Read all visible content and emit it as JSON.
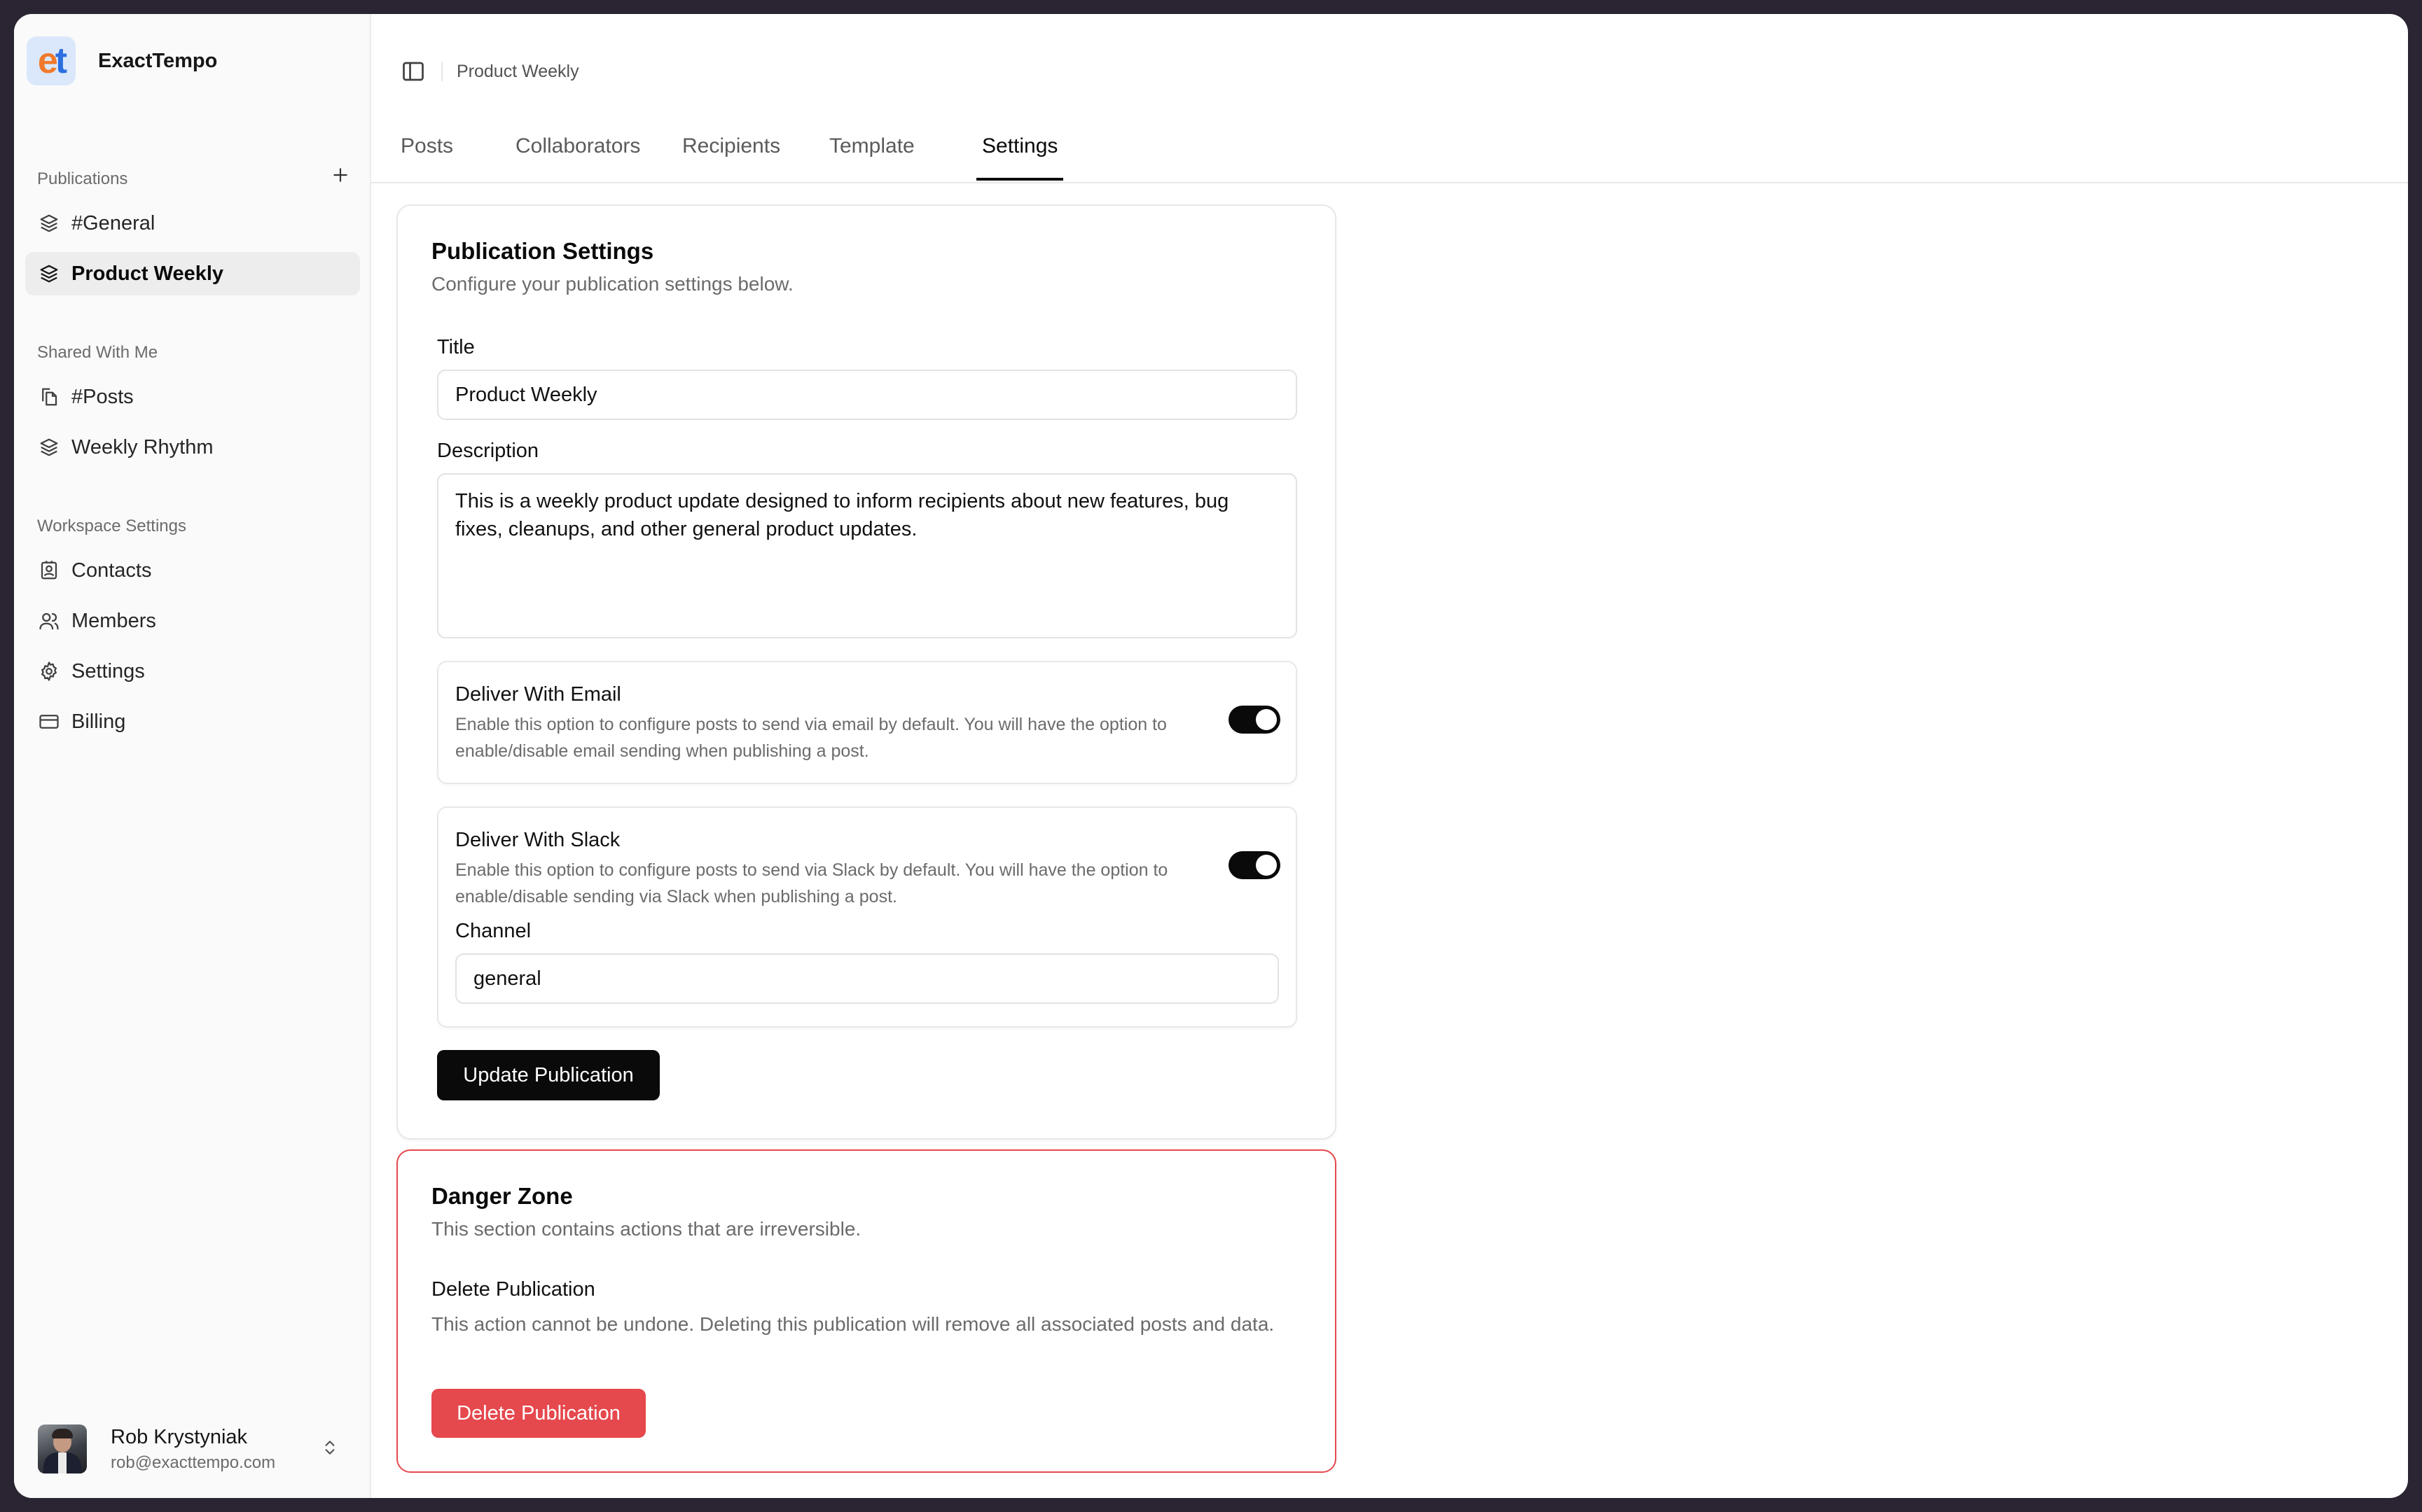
{
  "brand": {
    "logo_text_e": "e",
    "logo_text_t": "t",
    "name": "ExactTempo"
  },
  "sidebar": {
    "publications_label": "Publications",
    "publications": [
      {
        "label": "#General",
        "icon": "layers-icon"
      },
      {
        "label": "Product Weekly",
        "icon": "layers-icon",
        "active": true
      }
    ],
    "shared_label": "Shared With Me",
    "shared": [
      {
        "label": "#Posts",
        "icon": "files-icon"
      },
      {
        "label": "Weekly Rhythm",
        "icon": "layers-icon"
      }
    ],
    "workspace_label": "Workspace Settings",
    "workspace": [
      {
        "label": "Contacts",
        "icon": "contact-icon"
      },
      {
        "label": "Members",
        "icon": "users-icon"
      },
      {
        "label": "Settings",
        "icon": "gear-icon"
      },
      {
        "label": "Billing",
        "icon": "credit-card-icon"
      }
    ],
    "user": {
      "name": "Rob Krystyniak",
      "email": "rob@exacttempo.com"
    }
  },
  "header": {
    "breadcrumb": "Product Weekly"
  },
  "tabs": [
    {
      "label": "Posts"
    },
    {
      "label": "Collaborators"
    },
    {
      "label": "Recipients"
    },
    {
      "label": "Template"
    },
    {
      "label": "Settings",
      "active": true
    }
  ],
  "settings": {
    "title": "Publication Settings",
    "subtitle": "Configure your publication settings below.",
    "title_label": "Title",
    "title_value": "Product Weekly",
    "description_label": "Description",
    "description_value": "This is a weekly product update designed to inform recipients about new features, bug fixes, cleanups, and other general product updates.",
    "email": {
      "title": "Deliver With Email",
      "description": "Enable this option to configure posts to send via email by default. You will have the option to enable/disable email sending when publishing a post.",
      "enabled": true
    },
    "slack": {
      "title": "Deliver With Slack",
      "description": "Enable this option to configure posts to send via Slack by default. You will have the option to enable/disable sending via Slack when publishing a post.",
      "enabled": true,
      "channel_label": "Channel",
      "channel_value": "general"
    },
    "update_button": "Update Publication"
  },
  "danger": {
    "title": "Danger Zone",
    "subtitle": "This section contains actions that are irreversible.",
    "delete_title": "Delete Publication",
    "delete_description": "This action cannot be undone. Deleting this publication will remove all associated posts and data.",
    "delete_button": "Delete Publication"
  },
  "colors": {
    "accent": "#0a0a0a",
    "danger": "#e5484d",
    "sidebar_bg": "#fafafa"
  }
}
